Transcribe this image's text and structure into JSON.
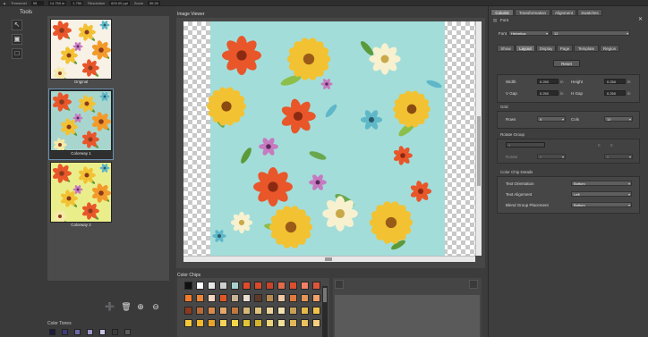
{
  "topbar": {
    "fields": [
      {
        "label": "Threshold",
        "value": "95"
      },
      {
        "label": "",
        "value": "14.750 in"
      },
      {
        "label": "",
        "value": "1.750"
      },
      {
        "label": "Resolution",
        "value": "600.00 ppi"
      },
      {
        "label": "Zoom",
        "value": "85.00"
      }
    ]
  },
  "tools": {
    "title": "Tools",
    "buttons": [
      "pointer-tool",
      "frame-tool",
      "rect-tool"
    ]
  },
  "thumbnails": [
    {
      "caption": "Original",
      "selected": false,
      "bg": "#f7f1e6"
    },
    {
      "caption": "Colorway 1",
      "selected": true,
      "bg": "#a8d6cf"
    },
    {
      "caption": "Colorway 2",
      "selected": false,
      "bg": "#eaee8a"
    }
  ],
  "thumb_actions": [
    "add-icon",
    "delete-icon",
    "zoom-in-icon",
    "zoom-out-icon"
  ],
  "color_tones": {
    "title": "Color Tones",
    "swatches": [
      "#1d1b40",
      "#3e3a7a",
      "#6e6aa8",
      "#9c97c8",
      "#c9c3e6",
      "#3b3b3b",
      "#5c5c5c"
    ]
  },
  "viewer": {
    "title": "Image Viewer",
    "pattern_bg": "#a3ddd9"
  },
  "color_chips": {
    "title": "Color Chips",
    "rows": [
      [
        "#111111",
        "#ffffff",
        "#e6e6e6",
        "#cfcfcf",
        "#a8d0cc",
        "#e14a2a",
        "#d9492a",
        "#c94428",
        "#e36a4a",
        "#db4f2e",
        "#f08166",
        "#e0553a"
      ],
      [
        "#f47a2a",
        "#ec8538",
        "#f3d6c0",
        "#e05626",
        "#c9b398",
        "#e8ddd0",
        "#5e3a2a",
        "#b88a50",
        "#efc8a5",
        "#dd7a3e",
        "#e09658",
        "#f0a06a"
      ],
      [
        "#8a3a1e",
        "#b86a3a",
        "#d98a4a",
        "#e3a86a",
        "#c07840",
        "#d6b878",
        "#e1c27a",
        "#ead196",
        "#f3e1b0",
        "#c7a058",
        "#e5b84a",
        "#f2c24a"
      ],
      [
        "#f7c83a",
        "#f2b92a",
        "#e9a52a",
        "#f5d25a",
        "#f2d84a",
        "#e3c436",
        "#d6b52e",
        "#ecd47a",
        "#f1e09a",
        "#e0b85a",
        "#eac060",
        "#f5d080"
      ]
    ]
  },
  "right_panel": {
    "tabs": [
      "Colorist",
      "Transformation",
      "Alignment",
      "Swatches"
    ],
    "active_tab": "Colorist",
    "font_label": "Font",
    "font_value": "Helvetica",
    "font_size": "12",
    "subtabs": [
      "Show",
      "Layout",
      "Display",
      "Page",
      "Template",
      "Region"
    ],
    "active_subtab": "Layout",
    "reset_label": "Reset",
    "size": {
      "width_label": "Width",
      "width_value": "0.250",
      "width_unit": "in",
      "height_label": "Height",
      "height_value": "0.250",
      "height_unit": "in",
      "vgap_label": "V Gap",
      "vgap_value": "0.250",
      "vgap_unit": "in",
      "hgap_label": "H Gap",
      "hgap_value": "0.250",
      "hgap_unit": "in"
    },
    "grid": {
      "title": "Grid",
      "rows_label": "Rows",
      "rows_value": "4",
      "cols_label": "Cols",
      "cols_value": "12"
    },
    "rotate": {
      "title": "Rotate Group",
      "value1": "0",
      "label_angle": "Rotate",
      "val_a": "0",
      "val_b": "0"
    },
    "details": {
      "title": "Color Chip Details",
      "text_orientation_label": "Text Orientation",
      "text_orientation_value": "Bottom",
      "text_alignment_label": "Text Alignment",
      "text_alignment_value": "Left",
      "blend_label": "Blend Group Placement",
      "blend_value": "Bottom"
    }
  }
}
